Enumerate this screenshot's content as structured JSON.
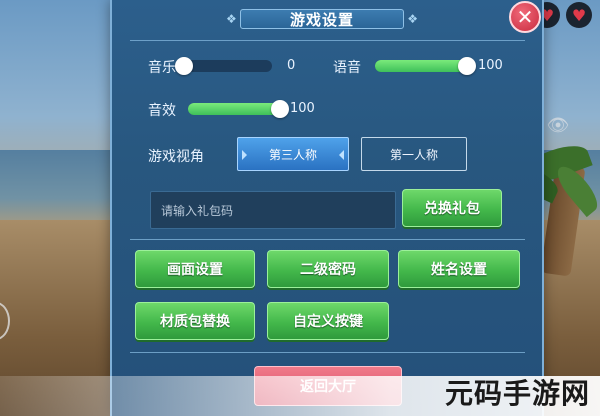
{
  "dialog": {
    "title": "游戏设置",
    "close_glyph": "✕"
  },
  "audio": {
    "music_label": "音乐",
    "music_value": "0",
    "music_level": 0,
    "voice_label": "语音",
    "voice_value": "100",
    "voice_level": 100,
    "sfx_label": "音效",
    "sfx_value": "100",
    "sfx_level": 100
  },
  "view": {
    "label": "游戏视角",
    "options": [
      "第三人称",
      "第一人称"
    ],
    "selected": "第三人称"
  },
  "gift": {
    "placeholder": "请输入礼包码",
    "redeem_label": "兑换礼包"
  },
  "buttons": {
    "display": "画面设置",
    "password": "二级密码",
    "name": "姓名设置",
    "texture": "材质包替换",
    "keys": "自定义按键"
  },
  "back_label": "返回大厅",
  "watermark": "元码手游网",
  "colors": {
    "accent_green": "#43b84b",
    "panel_blue": "#28577f",
    "close_red": "#c92a3e",
    "back_pink": "#d84a64"
  }
}
